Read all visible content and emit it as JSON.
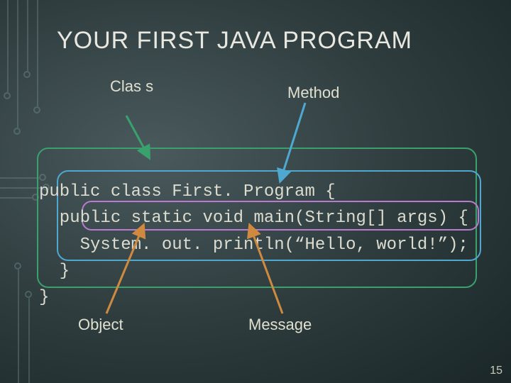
{
  "title": "YOUR FIRST JAVA PROGRAM",
  "labels": {
    "class": "Clas\ns",
    "method": "Method",
    "object": "Object",
    "message": "Message"
  },
  "code": {
    "line1": "public class First. Program {",
    "line2": "  public static void main(String[] args) {",
    "line3": "    System. out. println(“Hello, world!”);",
    "line4": "  }",
    "line5": "}"
  },
  "page_number": "15",
  "colors": {
    "box_outer": "#3aa06e",
    "box_mid": "#4fa8d0",
    "box_inner": "#b87bcf",
    "arrow_green": "#3aa06e",
    "arrow_blue": "#4fa8d0",
    "arrow_orange": "#d08a40"
  }
}
